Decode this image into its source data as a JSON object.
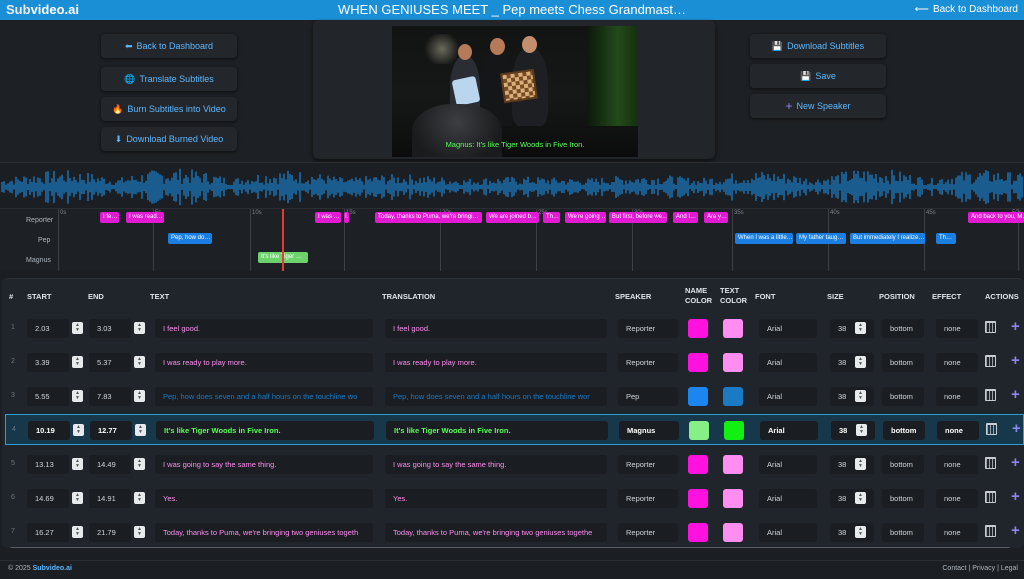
{
  "header": {
    "brand_sub": "Sub",
    "brand_rest": "video.ai",
    "title": "WHEN GENIUSES MEET _ Pep meets Chess Grandmast…",
    "back_label": "Back to Dashboard"
  },
  "left_buttons": [
    {
      "icon": "⬅",
      "label": "Back to Dashboard"
    },
    {
      "icon": "🌐",
      "label": "Translate Subtitles"
    },
    {
      "icon": "🔥",
      "label": "Burn Subtitles into Video"
    },
    {
      "icon": "⬇",
      "label": "Download Burned Video"
    }
  ],
  "right_buttons": [
    {
      "icon": "💾",
      "label": "Download Subtitles"
    },
    {
      "icon": "💾",
      "label": "Save"
    },
    {
      "icon": "+",
      "label": "New Speaker"
    }
  ],
  "video": {
    "subtitle_speaker": "Magnus:",
    "subtitle_text": "It's like Tiger Woods in Five Iron."
  },
  "timeline": {
    "lanes": [
      "Reporter",
      "Pep",
      "Magnus"
    ],
    "tick_labels": [
      "0s",
      "5s",
      "10s",
      "15s",
      "20s",
      "25s",
      "30s",
      "35s",
      "40s",
      "45s",
      "50s"
    ],
    "clips_reporter": [
      "I fe…",
      "I was read…",
      "I was …",
      "I…",
      "Today, thanks to Puma, we're bringi…",
      "We are joined b…",
      "Th…",
      "We're going …",
      "But first, before we…",
      "And I…",
      "Are y…",
      "And back to you, M…"
    ],
    "clips_pep": [
      "Pep, how do…",
      "When I was a little…",
      "My father taug…",
      "But immediately I realize…",
      "Th…"
    ],
    "clips_magnus": [
      "It's like Tiger …"
    ]
  },
  "table": {
    "headers": {
      "num": "#",
      "start": "START",
      "end": "END",
      "text": "TEXT",
      "translation": "TRANSLATION",
      "speaker": "SPEAKER",
      "name_color": "NAME\nCOLOR",
      "text_color": "TEXT\nCOLOR",
      "font": "FONT",
      "size": "SIZE",
      "position": "POSITION",
      "effect": "EFFECT",
      "actions": "ACTIONS"
    },
    "rows": [
      {
        "num": "1",
        "start": "2.03",
        "end": "3.03",
        "text": "I feel good.",
        "translation": "I feel good.",
        "speaker": "Reporter",
        "name_color": "#ff12e0",
        "text_color": "#ff8ef0",
        "font": "Arial",
        "size": "38",
        "position": "bottom",
        "effect": "none"
      },
      {
        "num": "2",
        "start": "3.39",
        "end": "5.37",
        "text": "I was ready to play more.",
        "translation": "I was ready to play more.",
        "speaker": "Reporter",
        "name_color": "#ff12e0",
        "text_color": "#ff8ef0",
        "font": "Arial",
        "size": "38",
        "position": "bottom",
        "effect": "none"
      },
      {
        "num": "3",
        "start": "5.55",
        "end": "7.83",
        "text": "Pep, how does seven and a half hours on the touchline wo",
        "translation": "Pep, how does seven and a half hours on the touchline wor",
        "speaker": "Pep",
        "name_color": "#1b86f0",
        "text_color": "#1a7ac4",
        "font": "Arial",
        "size": "38",
        "position": "bottom",
        "effect": "none"
      },
      {
        "num": "4",
        "start": "10.19",
        "end": "12.77",
        "text": "It's like Tiger Woods in Five Iron.",
        "translation": "It's like Tiger Woods in Five Iron.",
        "speaker": "Magnus",
        "name_color": "#86f086",
        "text_color": "#12f012",
        "font": "Arial",
        "size": "38",
        "position": "bottom",
        "effect": "none"
      },
      {
        "num": "5",
        "start": "13.13",
        "end": "14.49",
        "text": "I was going to say the same thing.",
        "translation": "I was going to say the same thing.",
        "speaker": "Reporter",
        "name_color": "#ff12e0",
        "text_color": "#ff8ef0",
        "font": "Arial",
        "size": "38",
        "position": "bottom",
        "effect": "none"
      },
      {
        "num": "6",
        "start": "14.69",
        "end": "14.91",
        "text": "Yes.",
        "translation": "Yes.",
        "speaker": "Reporter",
        "name_color": "#ff12e0",
        "text_color": "#ff8ef0",
        "font": "Arial",
        "size": "38",
        "position": "bottom",
        "effect": "none"
      },
      {
        "num": "7",
        "start": "16.27",
        "end": "21.79",
        "text": "Today, thanks to Puma, we're bringing two geniuses togeth",
        "translation": "Today, thanks to Puma, we're bringing two geniuses togethe",
        "speaker": "Reporter",
        "name_color": "#ff12e0",
        "text_color": "#ff8ef0",
        "font": "Arial",
        "size": "38",
        "position": "bottom",
        "effect": "none"
      }
    ]
  },
  "footer": {
    "copyright": "© 2025",
    "brand": "Subvideo.ai",
    "links": "Contact | Privacy | Legal"
  },
  "colors": {
    "accent": "#1a8fd6",
    "link": "#5db8ff",
    "reporter": "#e21ad4",
    "pep": "#1a7fe0",
    "magnus": "#6cd36c"
  }
}
